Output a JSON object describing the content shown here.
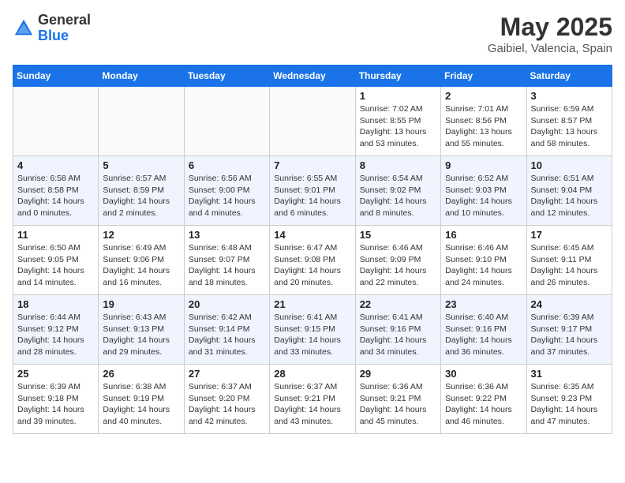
{
  "header": {
    "logo_general": "General",
    "logo_blue": "Blue",
    "month_year": "May 2025",
    "location": "Gaibiel, Valencia, Spain"
  },
  "weekdays": [
    "Sunday",
    "Monday",
    "Tuesday",
    "Wednesday",
    "Thursday",
    "Friday",
    "Saturday"
  ],
  "weeks": [
    [
      {
        "day": "",
        "empty": true
      },
      {
        "day": "",
        "empty": true
      },
      {
        "day": "",
        "empty": true
      },
      {
        "day": "",
        "empty": true
      },
      {
        "day": "1",
        "sunrise": "Sunrise: 7:02 AM",
        "sunset": "Sunset: 8:55 PM",
        "daylight": "Daylight: 13 hours and 53 minutes."
      },
      {
        "day": "2",
        "sunrise": "Sunrise: 7:01 AM",
        "sunset": "Sunset: 8:56 PM",
        "daylight": "Daylight: 13 hours and 55 minutes."
      },
      {
        "day": "3",
        "sunrise": "Sunrise: 6:59 AM",
        "sunset": "Sunset: 8:57 PM",
        "daylight": "Daylight: 13 hours and 58 minutes."
      }
    ],
    [
      {
        "day": "4",
        "sunrise": "Sunrise: 6:58 AM",
        "sunset": "Sunset: 8:58 PM",
        "daylight": "Daylight: 14 hours and 0 minutes."
      },
      {
        "day": "5",
        "sunrise": "Sunrise: 6:57 AM",
        "sunset": "Sunset: 8:59 PM",
        "daylight": "Daylight: 14 hours and 2 minutes."
      },
      {
        "day": "6",
        "sunrise": "Sunrise: 6:56 AM",
        "sunset": "Sunset: 9:00 PM",
        "daylight": "Daylight: 14 hours and 4 minutes."
      },
      {
        "day": "7",
        "sunrise": "Sunrise: 6:55 AM",
        "sunset": "Sunset: 9:01 PM",
        "daylight": "Daylight: 14 hours and 6 minutes."
      },
      {
        "day": "8",
        "sunrise": "Sunrise: 6:54 AM",
        "sunset": "Sunset: 9:02 PM",
        "daylight": "Daylight: 14 hours and 8 minutes."
      },
      {
        "day": "9",
        "sunrise": "Sunrise: 6:52 AM",
        "sunset": "Sunset: 9:03 PM",
        "daylight": "Daylight: 14 hours and 10 minutes."
      },
      {
        "day": "10",
        "sunrise": "Sunrise: 6:51 AM",
        "sunset": "Sunset: 9:04 PM",
        "daylight": "Daylight: 14 hours and 12 minutes."
      }
    ],
    [
      {
        "day": "11",
        "sunrise": "Sunrise: 6:50 AM",
        "sunset": "Sunset: 9:05 PM",
        "daylight": "Daylight: 14 hours and 14 minutes."
      },
      {
        "day": "12",
        "sunrise": "Sunrise: 6:49 AM",
        "sunset": "Sunset: 9:06 PM",
        "daylight": "Daylight: 14 hours and 16 minutes."
      },
      {
        "day": "13",
        "sunrise": "Sunrise: 6:48 AM",
        "sunset": "Sunset: 9:07 PM",
        "daylight": "Daylight: 14 hours and 18 minutes."
      },
      {
        "day": "14",
        "sunrise": "Sunrise: 6:47 AM",
        "sunset": "Sunset: 9:08 PM",
        "daylight": "Daylight: 14 hours and 20 minutes."
      },
      {
        "day": "15",
        "sunrise": "Sunrise: 6:46 AM",
        "sunset": "Sunset: 9:09 PM",
        "daylight": "Daylight: 14 hours and 22 minutes."
      },
      {
        "day": "16",
        "sunrise": "Sunrise: 6:46 AM",
        "sunset": "Sunset: 9:10 PM",
        "daylight": "Daylight: 14 hours and 24 minutes."
      },
      {
        "day": "17",
        "sunrise": "Sunrise: 6:45 AM",
        "sunset": "Sunset: 9:11 PM",
        "daylight": "Daylight: 14 hours and 26 minutes."
      }
    ],
    [
      {
        "day": "18",
        "sunrise": "Sunrise: 6:44 AM",
        "sunset": "Sunset: 9:12 PM",
        "daylight": "Daylight: 14 hours and 28 minutes."
      },
      {
        "day": "19",
        "sunrise": "Sunrise: 6:43 AM",
        "sunset": "Sunset: 9:13 PM",
        "daylight": "Daylight: 14 hours and 29 minutes."
      },
      {
        "day": "20",
        "sunrise": "Sunrise: 6:42 AM",
        "sunset": "Sunset: 9:14 PM",
        "daylight": "Daylight: 14 hours and 31 minutes."
      },
      {
        "day": "21",
        "sunrise": "Sunrise: 6:41 AM",
        "sunset": "Sunset: 9:15 PM",
        "daylight": "Daylight: 14 hours and 33 minutes."
      },
      {
        "day": "22",
        "sunrise": "Sunrise: 6:41 AM",
        "sunset": "Sunset: 9:16 PM",
        "daylight": "Daylight: 14 hours and 34 minutes."
      },
      {
        "day": "23",
        "sunrise": "Sunrise: 6:40 AM",
        "sunset": "Sunset: 9:16 PM",
        "daylight": "Daylight: 14 hours and 36 minutes."
      },
      {
        "day": "24",
        "sunrise": "Sunrise: 6:39 AM",
        "sunset": "Sunset: 9:17 PM",
        "daylight": "Daylight: 14 hours and 37 minutes."
      }
    ],
    [
      {
        "day": "25",
        "sunrise": "Sunrise: 6:39 AM",
        "sunset": "Sunset: 9:18 PM",
        "daylight": "Daylight: 14 hours and 39 minutes."
      },
      {
        "day": "26",
        "sunrise": "Sunrise: 6:38 AM",
        "sunset": "Sunset: 9:19 PM",
        "daylight": "Daylight: 14 hours and 40 minutes."
      },
      {
        "day": "27",
        "sunrise": "Sunrise: 6:37 AM",
        "sunset": "Sunset: 9:20 PM",
        "daylight": "Daylight: 14 hours and 42 minutes."
      },
      {
        "day": "28",
        "sunrise": "Sunrise: 6:37 AM",
        "sunset": "Sunset: 9:21 PM",
        "daylight": "Daylight: 14 hours and 43 minutes."
      },
      {
        "day": "29",
        "sunrise": "Sunrise: 6:36 AM",
        "sunset": "Sunset: 9:21 PM",
        "daylight": "Daylight: 14 hours and 45 minutes."
      },
      {
        "day": "30",
        "sunrise": "Sunrise: 6:36 AM",
        "sunset": "Sunset: 9:22 PM",
        "daylight": "Daylight: 14 hours and 46 minutes."
      },
      {
        "day": "31",
        "sunrise": "Sunrise: 6:35 AM",
        "sunset": "Sunset: 9:23 PM",
        "daylight": "Daylight: 14 hours and 47 minutes."
      }
    ]
  ]
}
